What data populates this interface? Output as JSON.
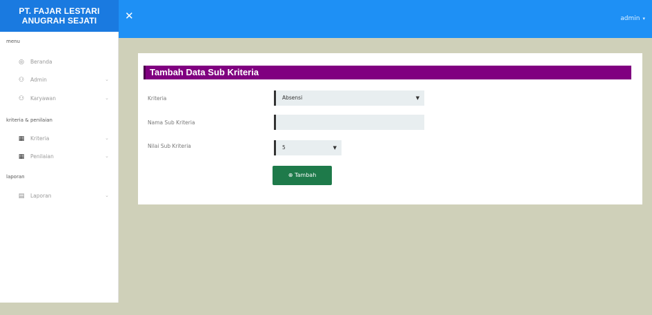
{
  "brand": {
    "line1": "PT. FAJAR LESTARI",
    "line2": "ANUGRAH SEJATI"
  },
  "header": {
    "toggle_icon": "✕",
    "user": "admin"
  },
  "sidebar": {
    "menu_label": "menu",
    "menu_items": [
      {
        "label": "Beranda",
        "icon": "◎"
      },
      {
        "label": "Admin",
        "icon": "⚇"
      },
      {
        "label": "Karyawan",
        "icon": "⚇"
      }
    ],
    "kriteria_label": "kriteria & penilaian",
    "kriteria_items": [
      {
        "label": "Kriteria",
        "icon": "▦"
      },
      {
        "label": "Penilaian",
        "icon": "▦"
      }
    ],
    "laporan_label": "laporan",
    "laporan_items": [
      {
        "label": "Laporan",
        "icon": "▤"
      }
    ]
  },
  "form": {
    "title": "Tambah Data Sub Kriteria",
    "kriteria_label": "Kriteria",
    "kriteria_value": "Absensi",
    "nama_label": "Nama Sub Kriteria",
    "nama_value": "",
    "nilai_label": "Nilai Sub Kriteria",
    "nilai_value": "5",
    "submit_label": "⊕ Tambah"
  },
  "colors": {
    "topbar": "#1e90f5",
    "title_bg": "#800080",
    "button": "#1e7a4a",
    "background": "#cfd0b9"
  }
}
